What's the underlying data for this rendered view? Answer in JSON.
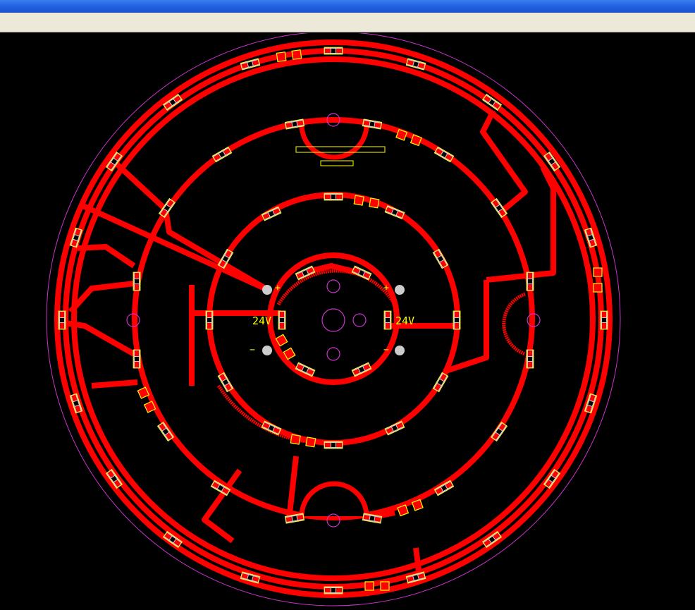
{
  "window": {
    "title": ""
  },
  "colors": {
    "background": "#000000",
    "copper": "#ff0000",
    "outline": "#cc33cc",
    "silkscreen": "#ffff00",
    "pad": "#cccccc",
    "titlebar": "#1f5fe0",
    "toolbar": "#ece9d8"
  },
  "board": {
    "labels": {
      "voltage_left": "24V",
      "voltage_right": "24V",
      "plus_left": "+",
      "plus_right": "+",
      "minus_left": "−",
      "minus_right": "−"
    }
  }
}
